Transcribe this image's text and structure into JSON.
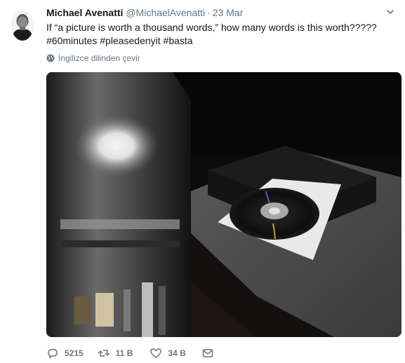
{
  "author": {
    "name": "Michael Avenatti",
    "handle": "@MichaelAvenatti",
    "separator": "·",
    "date": "23 Mar"
  },
  "tweet": {
    "line1": "If “a picture is worth a thousand words,” how many words is this worth?????",
    "line2": "#60minutes #pleasedenyit #basta"
  },
  "translate_label": "İngilizce dilinden çevir",
  "actions": {
    "replies": "5215",
    "retweets": "11 B",
    "likes": "34 B"
  },
  "icons": {
    "caret": "chevron-down-icon",
    "translate": "globe-icon",
    "reply": "reply-icon",
    "retweet": "retweet-icon",
    "like": "heart-icon",
    "message": "envelope-icon"
  },
  "colors": {
    "text": "#14171a",
    "secondary": "#657786"
  }
}
